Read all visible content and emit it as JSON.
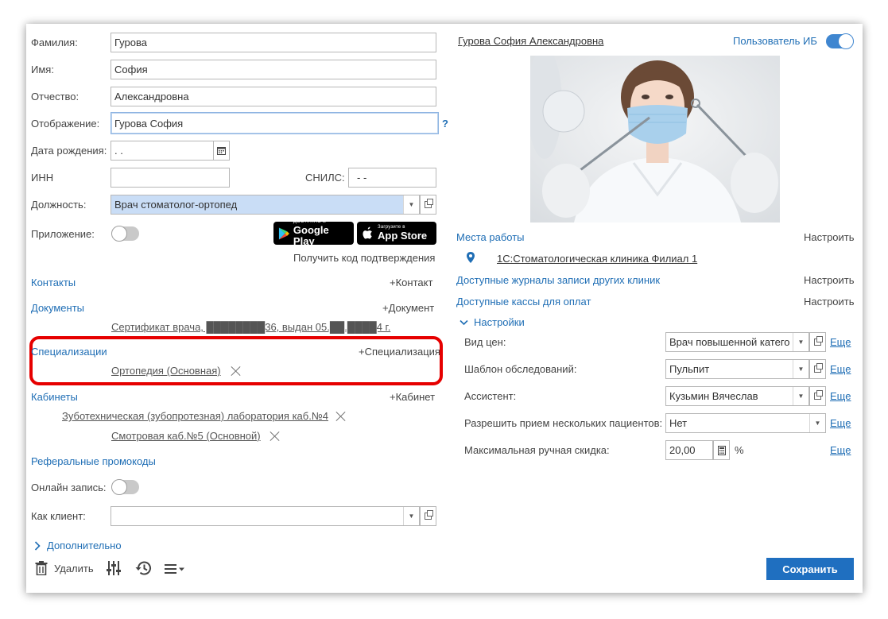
{
  "form": {
    "surname_label": "Фамилия:",
    "surname_value": "Гурова",
    "name_label": "Имя:",
    "name_value": "София",
    "patronymic_label": "Отчество:",
    "patronymic_value": "Александровна",
    "display_label": "Отображение:",
    "display_value": "Гурова София",
    "help": "?",
    "birthdate_label": "Дата рождения:",
    "birthdate_value": " .  .",
    "inn_label": "ИНН",
    "inn_value": "",
    "snils_label": "СНИЛС:",
    "snils_value": "  -   -",
    "position_label": "Должность:",
    "position_value": "Врач стоматолог-ортопед",
    "app_label": "Приложение:",
    "google_small": "ДОСТУПНО В",
    "google_big": "Google Play",
    "apple_small": "Загрузите в",
    "apple_big": "App Store",
    "confirm_code": "Получить код подтверждения",
    "contacts": "Контакты",
    "add_contact": "+Контакт",
    "documents": "Документы",
    "add_document": "+Документ",
    "document_item": "Сертификат врача, ████████36, выдан 05.██.████4 г.",
    "specializations": "Специализации",
    "add_specialization": "+Специализация",
    "specialization_item": "Ортопедия (Основная)",
    "cabinets": "Кабинеты",
    "add_cabinet": "+Кабинет",
    "cabinet_1": "Зуботехническая (зубопротезная) лаборатория каб.№4",
    "cabinet_2": "Смотровая каб.№5 (Основной)",
    "promo": "Реферальные промокоды",
    "online_label": "Онлайн запись:",
    "client_label": "Как клиент:",
    "client_value": "",
    "additional": "Дополнительно",
    "delete": "Удалить"
  },
  "right": {
    "fullname": "Гурова София Александровна",
    "ib_user": "Пользователь ИБ",
    "workplaces": "Места работы",
    "configure": "Настроить",
    "clinic": "1С:Стоматологическая клиника Филиал 1",
    "journals": "Доступные журналы записи других клиник",
    "cashboxes": "Доступные кассы для оплат",
    "settings": "Настройки",
    "price_label": "Вид цен:",
    "price_value": "Врач повышенной катего",
    "template_label": "Шаблон обследований:",
    "template_value": "Пульпит",
    "assistant_label": "Ассистент:",
    "assistant_value": "Кузьмин Вячеслав",
    "multi_label": "Разрешить прием нескольких пациентов:",
    "multi_value": "Нет",
    "discount_label": "Максимальная ручная скидка:",
    "discount_value": "20,00",
    "percent": "%",
    "more": "Еще",
    "save": "Сохранить"
  },
  "icons": [
    "calendar-icon",
    "dropdown-arrow-icon",
    "open-form-icon",
    "location-pin-icon",
    "close-icon",
    "chevron-right-icon",
    "chevron-down-icon",
    "trash-icon",
    "sliders-icon",
    "history-icon",
    "menu-icon",
    "google-play-icon",
    "apple-icon"
  ],
  "colors": {
    "accent": "#1f6eb5",
    "save_button": "#1f6fc0",
    "toggle_on": "#3f86d0",
    "highlight": "#e60000",
    "position_field": "#c9ddf6"
  }
}
